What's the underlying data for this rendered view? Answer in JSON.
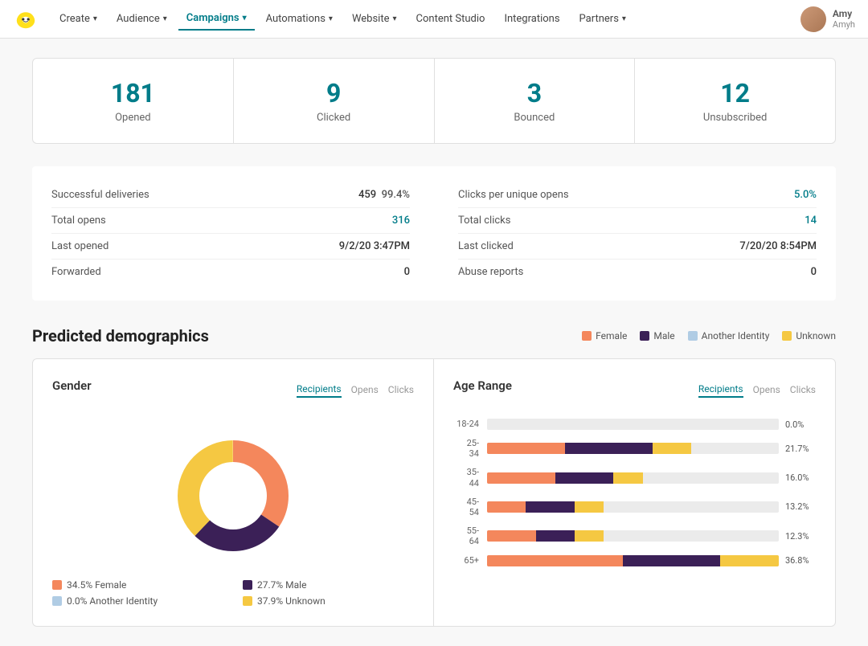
{
  "nav": {
    "logo_alt": "Mailchimp",
    "items": [
      {
        "label": "Create",
        "has_chevron": true,
        "active": false
      },
      {
        "label": "Audience",
        "has_chevron": true,
        "active": false
      },
      {
        "label": "Campaigns",
        "has_chevron": true,
        "active": true
      },
      {
        "label": "Automations",
        "has_chevron": true,
        "active": false
      },
      {
        "label": "Website",
        "has_chevron": true,
        "active": false
      },
      {
        "label": "Content Studio",
        "has_chevron": false,
        "active": false
      },
      {
        "label": "Integrations",
        "has_chevron": false,
        "active": false
      },
      {
        "label": "Partners",
        "has_chevron": true,
        "active": false
      }
    ],
    "user_name": "Amy",
    "user_handle": "Amyh"
  },
  "stats": [
    {
      "number": "181",
      "label": "Opened"
    },
    {
      "number": "9",
      "label": "Clicked"
    },
    {
      "number": "3",
      "label": "Bounced"
    },
    {
      "number": "12",
      "label": "Unsubscribed"
    }
  ],
  "metrics_left": [
    {
      "label": "Successful deliveries",
      "value": "459  99.4%",
      "blue": false
    },
    {
      "label": "Total opens",
      "value": "316",
      "blue": true
    },
    {
      "label": "Last opened",
      "value": "9/2/20 3:47PM",
      "blue": false
    },
    {
      "label": "Forwarded",
      "value": "0",
      "blue": false
    }
  ],
  "metrics_right": [
    {
      "label": "Clicks per unique opens",
      "value": "5.0%",
      "blue": true
    },
    {
      "label": "Total clicks",
      "value": "14",
      "blue": true
    },
    {
      "label": "Last clicked",
      "value": "7/20/20 8:54PM",
      "blue": false
    },
    {
      "label": "Abuse reports",
      "value": "0",
      "blue": false
    }
  ],
  "demographics": {
    "title": "Predicted demographics",
    "legend": [
      {
        "label": "Female",
        "color": "#f4875c"
      },
      {
        "label": "Male",
        "color": "#3b2057"
      },
      {
        "label": "Another Identity",
        "color": "#b0cce4"
      },
      {
        "label": "Unknown",
        "color": "#f5c842"
      }
    ]
  },
  "gender_chart": {
    "title": "Gender",
    "tabs": [
      "Recipients",
      "Opens",
      "Clicks"
    ],
    "active_tab": "Recipients",
    "segments": [
      {
        "label": "Female",
        "percent": 34.5,
        "color": "#f4875c"
      },
      {
        "label": "Male",
        "percent": 27.7,
        "color": "#3b2057"
      },
      {
        "label": "Another Identity",
        "percent": 0.0,
        "color": "#b0cce4"
      },
      {
        "label": "Unknown",
        "percent": 37.9,
        "color": "#f5c842"
      }
    ],
    "legend": [
      {
        "label": "34.5% Female",
        "color": "#f4875c"
      },
      {
        "label": "27.7% Male",
        "color": "#3b2057"
      },
      {
        "label": "0.0% Another Identity",
        "color": "#b0cce4"
      },
      {
        "label": "37.9% Unknown",
        "color": "#f5c842"
      }
    ]
  },
  "age_chart": {
    "title": "Age Range",
    "tabs": [
      "Recipients",
      "Opens",
      "Clicks"
    ],
    "active_tab": "Recipients",
    "rows": [
      {
        "label": "18-24",
        "percent_label": "0.0%",
        "female": 0,
        "male": 0,
        "other": 0,
        "unknown": 0
      },
      {
        "label": "25-\n34",
        "percent_label": "21.7%",
        "female": 8,
        "male": 9,
        "other": 0,
        "unknown": 4
      },
      {
        "label": "35-\n44",
        "percent_label": "16.0%",
        "female": 7,
        "male": 6,
        "other": 0,
        "unknown": 3
      },
      {
        "label": "45-\n54",
        "percent_label": "13.2%",
        "female": 4,
        "male": 5,
        "other": 0,
        "unknown": 3
      },
      {
        "label": "55-\n64",
        "percent_label": "12.3%",
        "female": 5,
        "male": 4,
        "other": 0,
        "unknown": 3
      },
      {
        "label": "65+",
        "percent_label": "36.8%",
        "female": 14,
        "male": 10,
        "other": 0,
        "unknown": 6
      }
    ]
  },
  "colors": {
    "teal": "#007c89",
    "female": "#f4875c",
    "male": "#3b2057",
    "other": "#b0cce4",
    "unknown": "#f5c842",
    "track": "#ebebeb"
  }
}
